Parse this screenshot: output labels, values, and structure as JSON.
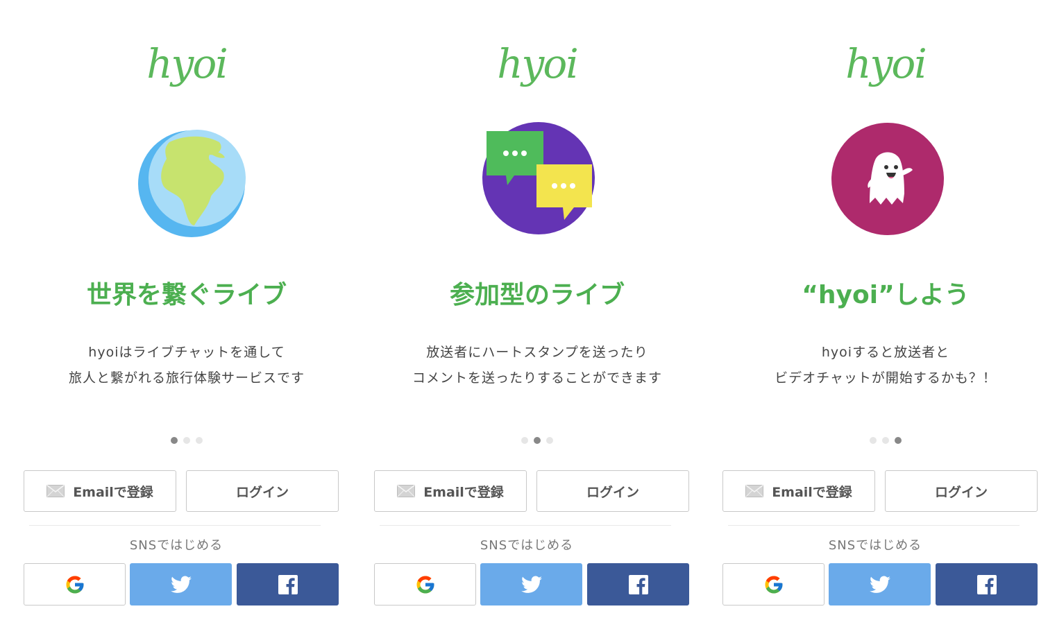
{
  "brand": {
    "logo": "hyoi",
    "color": "#5cb85c"
  },
  "panels": [
    {
      "illustration": "globe-icon",
      "headline": "世界を繋ぐライブ",
      "desc_line1": "hyoiはライブチャットを通して",
      "desc_line2": "旅人と繋がれる旅行体験サービスです",
      "page": 1,
      "pages": 3,
      "email_label": "Emailで登録",
      "login_label": "ログイン",
      "sns_label": "SNSではじめる"
    },
    {
      "illustration": "chat-bubbles-icon",
      "headline": "参加型のライブ",
      "desc_line1": "放送者にハートスタンプを送ったり",
      "desc_line2": "コメントを送ったりすることができます",
      "page": 2,
      "pages": 3,
      "email_label": "Emailで登録",
      "login_label": "ログイン",
      "sns_label": "SNSではじめる"
    },
    {
      "illustration": "ghost-icon",
      "headline": "“hyoi”しよう",
      "desc_line1": "hyoiすると放送者と",
      "desc_line2": "ビデオチャットが開始するかも？！",
      "page": 3,
      "pages": 3,
      "email_label": "Emailで登録",
      "login_label": "ログイン",
      "sns_label": "SNSではじめる"
    }
  ],
  "colors": {
    "headline": "#4caf50",
    "twitter": "#6aaaea",
    "facebook": "#3b5998",
    "dot_active": "#888888",
    "dot_inactive": "#e6e6e6"
  },
  "sns_icons": [
    "google-icon",
    "twitter-icon",
    "facebook-icon"
  ]
}
